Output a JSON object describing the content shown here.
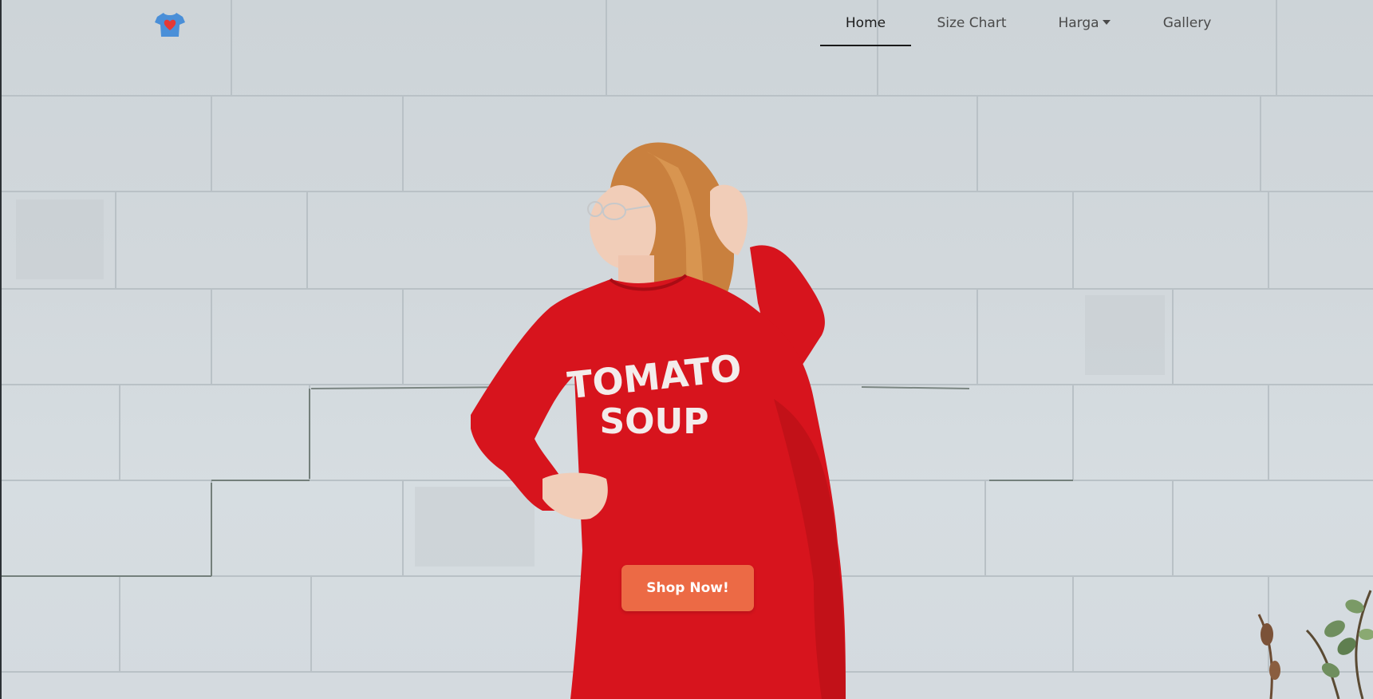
{
  "navbar": {
    "logo_icon": "tshirt-heart-icon",
    "items": [
      {
        "label": "Home",
        "active": true
      },
      {
        "label": "Size Chart",
        "active": false
      },
      {
        "label": "Harga",
        "active": false,
        "dropdown": true
      },
      {
        "label": "Gallery",
        "active": false
      }
    ]
  },
  "hero": {
    "sweater_text_line1": "TOMATO",
    "sweater_text_line2": "SOUP",
    "cta_label": "Shop Now!"
  },
  "colors": {
    "accent": "#ec6a45",
    "sweater": "#d7141d",
    "wall": "#d2d8dc",
    "nav_text": "#4a4a4a",
    "active_underline": "#1a1a1a"
  }
}
